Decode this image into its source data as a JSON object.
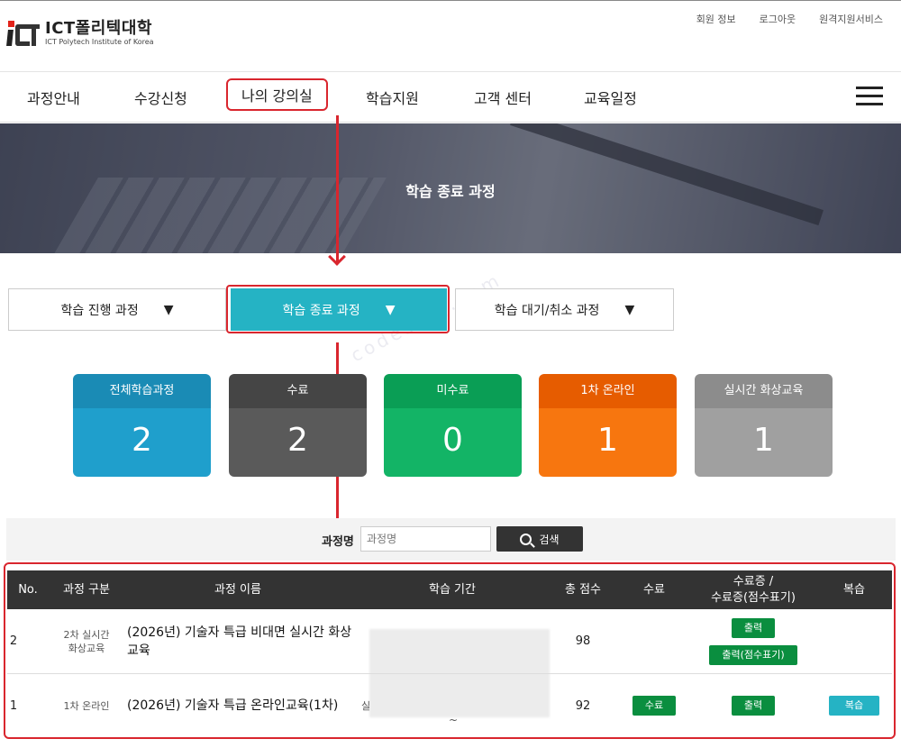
{
  "brand": {
    "name": "ICT폴리텍대학",
    "sub": "ICT Polytech Institute of Korea"
  },
  "top_links": [
    "회원 정보",
    "로그아웃",
    "원격지원서비스"
  ],
  "nav": [
    "과정안내",
    "수강신청",
    "나의 강의실",
    "학습지원",
    "고객 센터",
    "교육일정"
  ],
  "banner": {
    "title": "학습 종료 과정"
  },
  "tabs": [
    {
      "label": "학습 진행 과정",
      "arrow": "▼"
    },
    {
      "label": "학습 종료 과정",
      "arrow": "▼"
    },
    {
      "label": "학습 대기/취소 과정",
      "arrow": "▼"
    }
  ],
  "stats": [
    {
      "label": "전체학습과정",
      "value": "2",
      "head_color": "#1a8bb5",
      "body_color": "#1f9fcc"
    },
    {
      "label": "수료",
      "value": "2",
      "head_color": "#454545",
      "body_color": "#5a5a5a"
    },
    {
      "label": "미수료",
      "value": "0",
      "head_color": "#0a9e55",
      "body_color": "#13b466"
    },
    {
      "label": "1차 온라인",
      "value": "1",
      "head_color": "#e65c00",
      "body_color": "#f7760f"
    },
    {
      "label": "실시간 화상교육",
      "value": "1",
      "head_color": "#8c8c8c",
      "body_color": "#a0a0a0"
    }
  ],
  "search": {
    "label": "과정명",
    "placeholder": "과정명",
    "button": "검색"
  },
  "table": {
    "headers": [
      "No.",
      "과정 구분",
      "과정 이름",
      "학습 기간",
      "총 점수",
      "수료",
      "수료증 /\n수료증(점수표기)",
      "복습"
    ],
    "rows": [
      {
        "no": "2",
        "type": "2차 실시간\n화상교육",
        "name": "(2026년) 기술자 특급 비대면 실시간 화상교육",
        "score": "98",
        "print": "출력",
        "print_score": "출력(점수표기)"
      },
      {
        "no": "1",
        "type": "1차 온라인",
        "name": "(2026년) 기술자 특급 온라인교육(1차)",
        "period_prefix": "실",
        "period_tilde": "~",
        "score": "92",
        "complete": "수료",
        "print": "출력",
        "review": "복습"
      }
    ]
  },
  "watermark": "codeslog.com"
}
